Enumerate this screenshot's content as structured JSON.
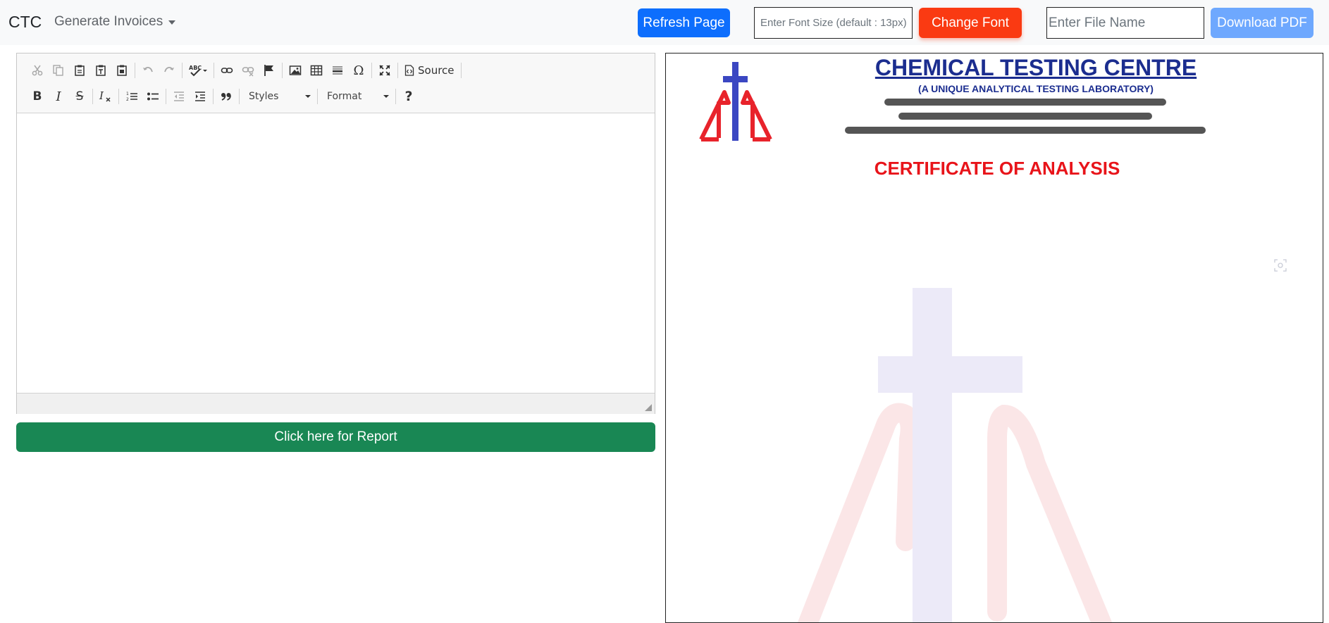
{
  "navbar": {
    "brand": "CTC",
    "menu_label": "Generate Invoices",
    "refresh_label": "Refresh Page",
    "font_size_placeholder": "Enter Font Size (default : 13px)",
    "change_font_label": "Change Font",
    "file_name_placeholder": "Enter File Name",
    "download_label": "Download PDF"
  },
  "editor": {
    "toolbar": {
      "source_label": "Source",
      "styles_label": "Styles",
      "format_label": "Format",
      "bold_glyph": "B",
      "italic_glyph": "I",
      "strike_glyph": "S",
      "help_glyph": "?",
      "special_char_glyph": "Ω"
    },
    "content": ""
  },
  "report_button_label": "Click here for Report",
  "preview": {
    "org_name": "CHEMICAL TESTING CENTRE",
    "org_subtitle": "(A UNIQUE ANALYTICAL TESTING LABORATORY)",
    "certificate_title": "CERTIFICATE OF ANALYSIS"
  },
  "colors": {
    "primary": "#0d6efd",
    "change_font": "#fa3a12",
    "download_disabled": "#6ea8fe",
    "report_green": "#198754",
    "org_blue": "#1b2d8f",
    "certificate_red": "#e8141a",
    "logo_red": "#e8232b",
    "logo_blue": "#3b47c2"
  },
  "icons": [
    "cut-icon",
    "copy-icon",
    "paste-icon",
    "paste-text-icon",
    "paste-word-icon",
    "undo-icon",
    "redo-icon",
    "spellcheck-icon",
    "link-icon",
    "unlink-icon",
    "anchor-icon",
    "image-icon",
    "table-icon",
    "horizontal-rule-icon",
    "special-char-icon",
    "maximize-icon",
    "source-icon",
    "remove-format-icon",
    "numbered-list-icon",
    "bulleted-list-icon",
    "outdent-icon",
    "indent-icon",
    "blockquote-icon",
    "help-icon"
  ]
}
